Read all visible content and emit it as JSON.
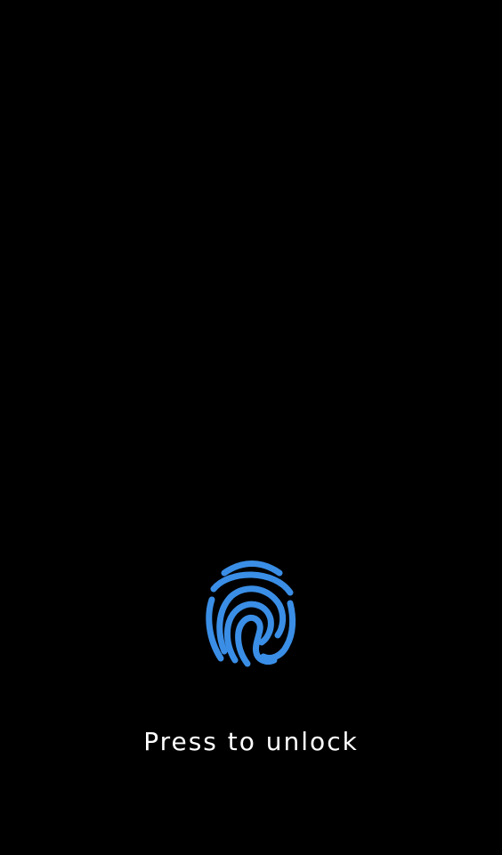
{
  "lock_screen": {
    "hint_text": "Press to unlock",
    "fingerprint_icon": "fingerprint-icon",
    "accent_color": "#3a8ee6",
    "background_color": "#000000",
    "text_color": "#ffffff"
  }
}
